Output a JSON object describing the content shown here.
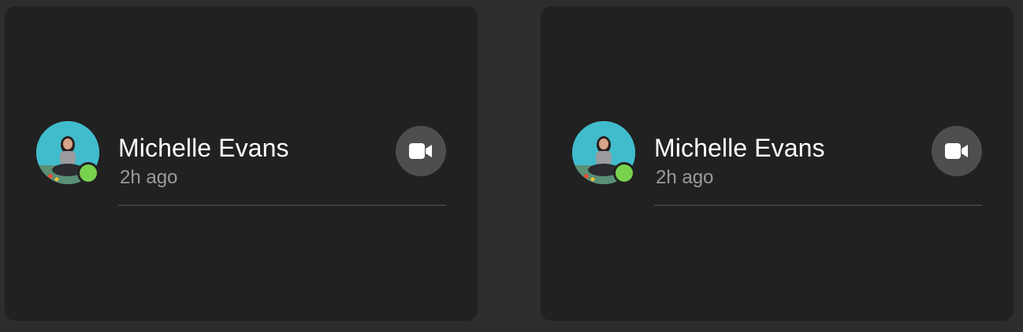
{
  "contacts": [
    {
      "name": "Michelle Evans",
      "time": "2h ago",
      "status": "online",
      "status_color": "#77d24d",
      "action_icon": "video-camera-icon"
    },
    {
      "name": "Michelle Evans",
      "time": "2h ago",
      "status": "online",
      "status_color": "#77d24d",
      "action_icon": "video-camera-icon"
    }
  ]
}
